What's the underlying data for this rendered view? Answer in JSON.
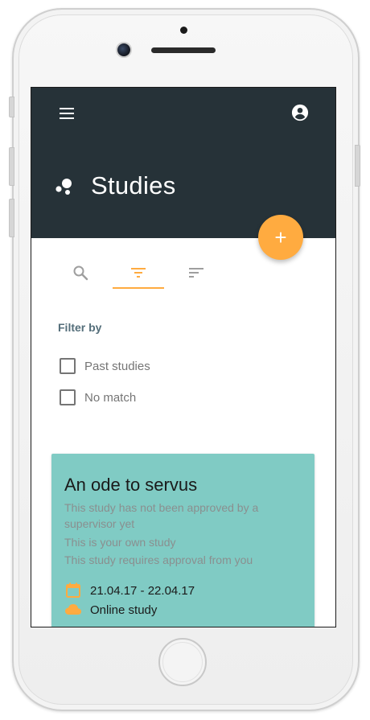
{
  "app": {
    "title": "Studies"
  },
  "tabs": [
    {
      "icon": "search-icon",
      "selected": false
    },
    {
      "icon": "filter-icon",
      "selected": true
    },
    {
      "icon": "sort-icon",
      "selected": false
    }
  ],
  "filter": {
    "heading": "Filter by",
    "options": [
      {
        "label": "Past studies",
        "checked": false
      },
      {
        "label": "No match",
        "checked": false
      }
    ]
  },
  "study_card": {
    "title": "An ode to servus",
    "notes": [
      "This study has not been approved by a supervisor yet",
      "This is your own study",
      "This study requires approval from you"
    ],
    "dates": "21.04.17 - 22.04.17",
    "location": "Online study"
  },
  "fab": {
    "label": "+"
  },
  "colors": {
    "appbar": "#263238",
    "accent": "#ffab40",
    "card": "#80cbc4",
    "filter_heading": "#546e7a"
  }
}
